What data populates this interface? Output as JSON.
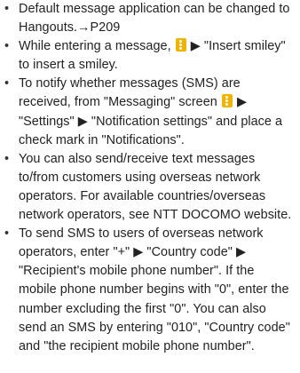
{
  "bullet_symbol": "•",
  "menu_icon": {
    "name": "menu-icon",
    "color": "#f0b400"
  },
  "notes": [
    {
      "text": "Default message application can be changed to Hangouts.→P209"
    },
    {
      "before": "While entering a message,",
      "after": "▶ \"Insert smiley\" to insert a smiley."
    },
    {
      "before": "To notify whether messages (SMS) are received, from \"Messaging\" screen",
      "after": "▶ \"Settings\" ▶ \"Notification settings\" and place a check mark in \"Notifications\"."
    },
    {
      "text": "You can also send/receive text messages to/from customers using overseas network operators. For available countries/overseas network operators, see NTT DOCOMO website."
    },
    {
      "text": "To send SMS to users of overseas network operators, enter \"+\" ▶ \"Country code\" ▶ \"Recipient's mobile phone number\". If the mobile phone number begins with \"0\", enter the number excluding the first \"0\". You can also send an SMS by entering \"010\", \"Country code\" and \"the recipient mobile phone number\"."
    }
  ]
}
